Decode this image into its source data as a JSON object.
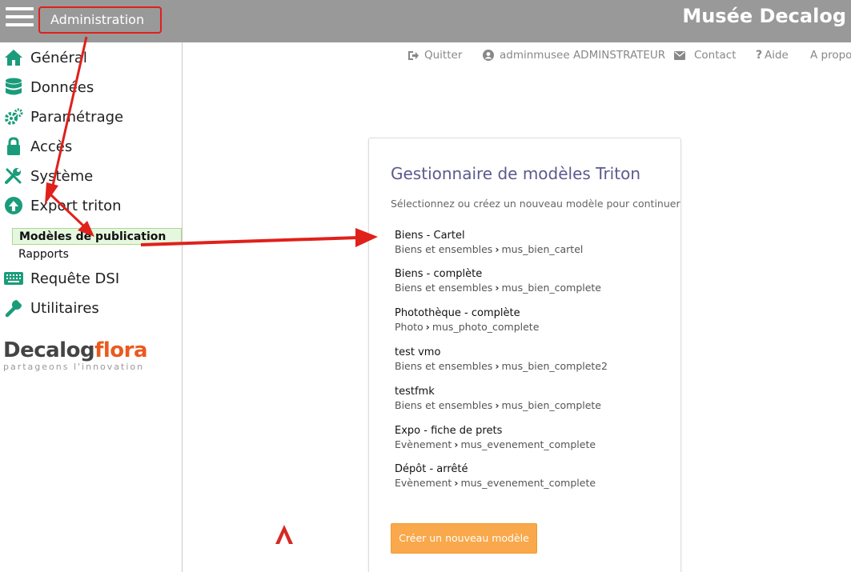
{
  "header": {
    "admin_label": "Administration",
    "brand": "Musée Decalog"
  },
  "sidebar": {
    "items": [
      {
        "label": "Général",
        "icon": "home-icon"
      },
      {
        "label": "Données",
        "icon": "database-icon"
      },
      {
        "label": "Paramétrage",
        "icon": "cogs-icon"
      },
      {
        "label": "Accès",
        "icon": "lock-icon"
      },
      {
        "label": "Système",
        "icon": "wrench-screwdriver-icon"
      },
      {
        "label": "Export triton",
        "icon": "cloud-upload-icon"
      }
    ],
    "subitems": [
      {
        "label": "Modèles de publication",
        "active": true
      },
      {
        "label": "Rapports",
        "active": false
      }
    ],
    "items_after": [
      {
        "label": "Requête DSI",
        "icon": "keyboard-icon"
      },
      {
        "label": "Utilitaires",
        "icon": "wrench-icon"
      }
    ],
    "logo": {
      "brand_a": "Decalog",
      "brand_b": "flora",
      "tagline": "partageons l'innovation"
    }
  },
  "toplinks": [
    {
      "label": "Quitter",
      "icon": "sign-out-icon"
    },
    {
      "label": "adminmusee ADMINSTRATEUR",
      "icon": "user-icon"
    },
    {
      "label": "Contact",
      "icon": "envelope-icon"
    },
    {
      "label": "Aide",
      "icon": "question-icon"
    },
    {
      "label": "A propo",
      "icon": ""
    }
  ],
  "card": {
    "title": "Gestionnaire de modèles Triton",
    "subtitle": "Sélectionnez ou créez un nouveau modèle pour continuer",
    "models": [
      {
        "name": "Biens - Cartel",
        "category": "Biens et ensembles",
        "table": "mus_bien_cartel"
      },
      {
        "name": "Biens - complète",
        "category": "Biens et ensembles",
        "table": "mus_bien_complete"
      },
      {
        "name": "Photothèque - complète",
        "category": "Photo",
        "table": "mus_photo_complete"
      },
      {
        "name": "test vmo",
        "category": "Biens et ensembles",
        "table": "mus_bien_complete2"
      },
      {
        "name": "testfmk",
        "category": "Biens et ensembles",
        "table": "mus_bien_complete"
      },
      {
        "name": "Expo - fiche de prets",
        "category": "Evènement",
        "table": "mus_evenement_complete"
      },
      {
        "name": "Dépôt - arrêté",
        "category": "Evènement",
        "table": "mus_evenement_complete"
      }
    ],
    "create_button": "Créer un nouveau modèle"
  },
  "colors": {
    "header_bg": "#999999",
    "annotation_red": "#e0201b",
    "icon_green": "#1a9c7a",
    "title_purple": "#5b5a8c",
    "button_orange": "#f9a84b",
    "active_bg": "#e6f7df"
  }
}
